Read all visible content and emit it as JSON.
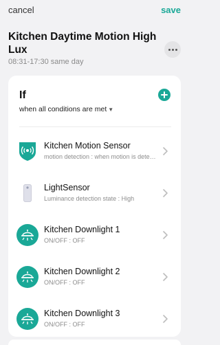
{
  "header": {
    "cancel_label": "cancel",
    "save_label": "save",
    "title": "Kitchen Daytime Motion High Lux",
    "schedule": "08:31-17:30 same day"
  },
  "condition_card": {
    "heading": "If",
    "mode_label": "when all conditions are met",
    "items": [
      {
        "name": "Kitchen Motion Sensor",
        "detail": "motion detection : when motion is detected",
        "icon": "motion-sensor-icon"
      },
      {
        "name": "LightSensor",
        "detail": "Luminance detection state : High",
        "icon": "light-sensor-icon"
      },
      {
        "name": "Kitchen Downlight 1",
        "detail": "ON/OFF : OFF",
        "icon": "downlight-icon"
      },
      {
        "name": "Kitchen Downlight 2",
        "detail": "ON/OFF : OFF",
        "icon": "downlight-icon"
      },
      {
        "name": "Kitchen Downlight 3",
        "detail": "ON/OFF : OFF",
        "icon": "downlight-icon"
      }
    ]
  },
  "colors": {
    "accent": "#1aa897",
    "background": "#f2f2f4"
  }
}
